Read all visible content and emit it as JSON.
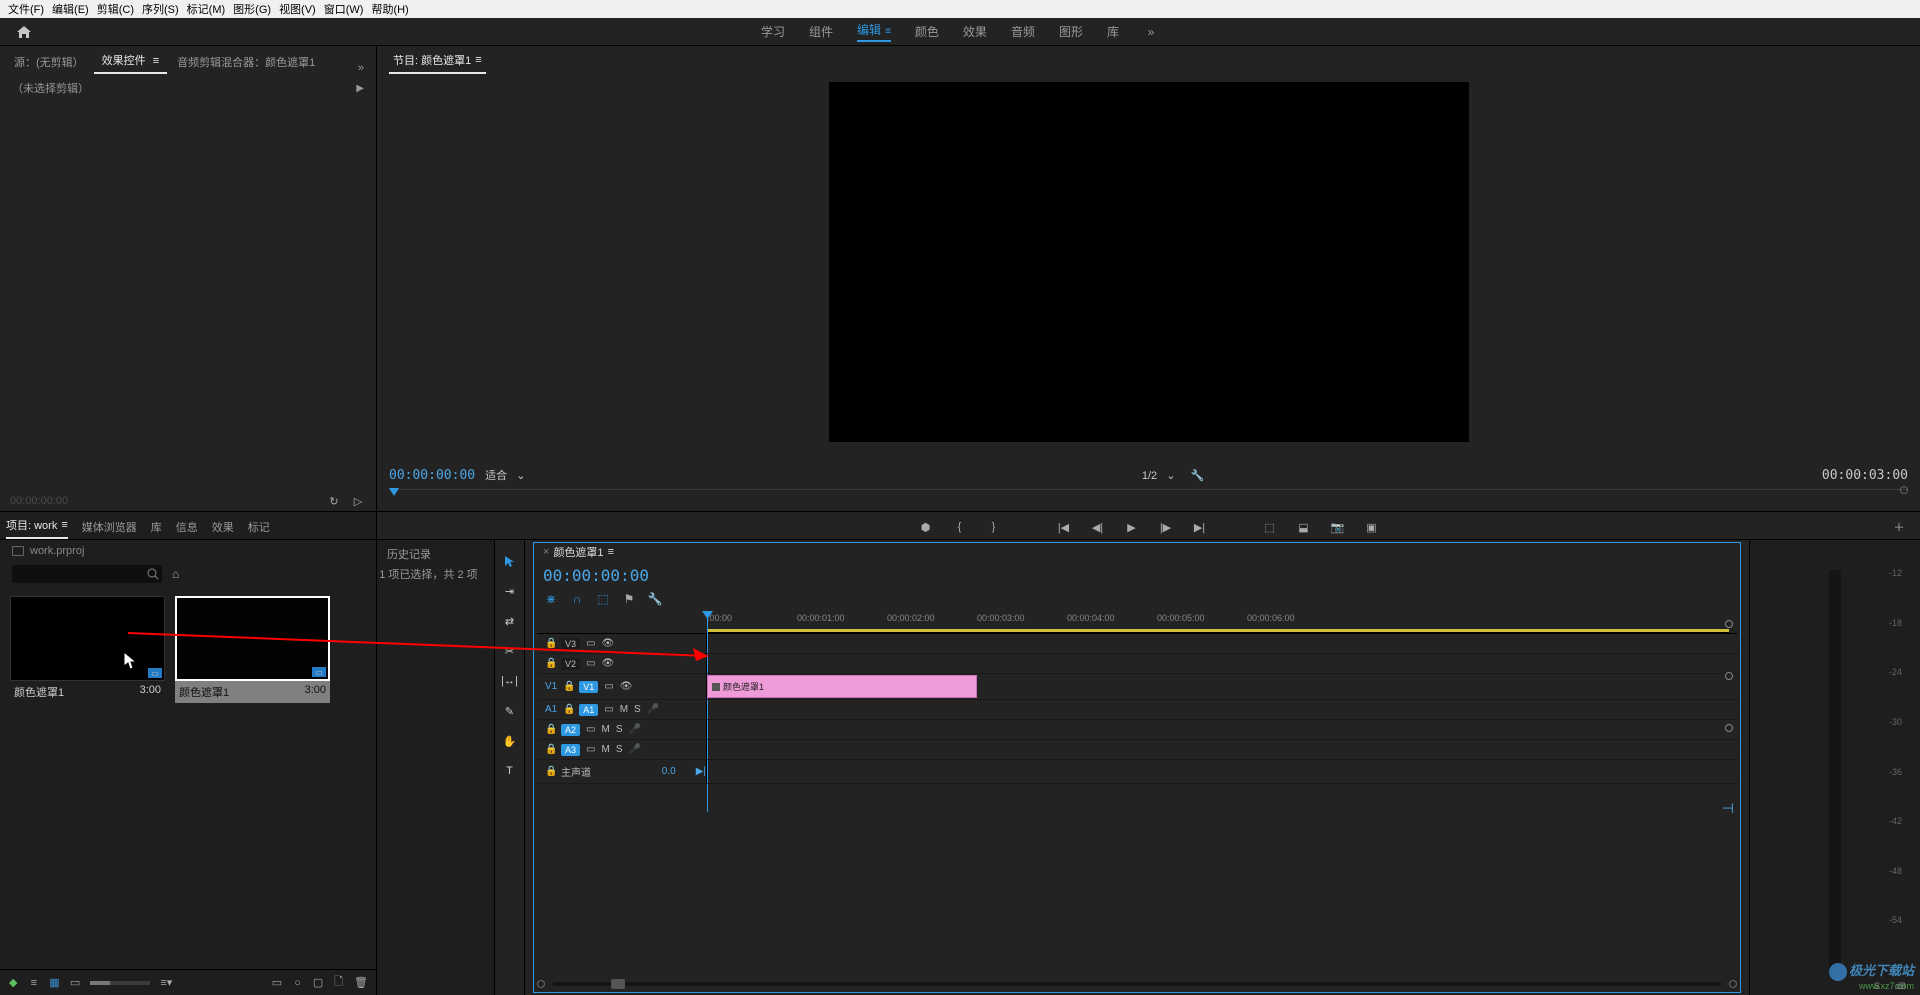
{
  "menu": {
    "file": "文件(F)",
    "edit": "编辑(E)",
    "clip": "剪辑(C)",
    "sequence": "序列(S)",
    "marker": "标记(M)",
    "graphics": "图形(G)",
    "view": "视图(V)",
    "window": "窗口(W)",
    "help": "帮助(H)"
  },
  "workspaces": {
    "learn": "学习",
    "assembly": "组件",
    "edit": "编辑",
    "color": "颜色",
    "effects": "效果",
    "audio": "音频",
    "graphics": "图形",
    "library": "库"
  },
  "source_panel": {
    "tab_source": "源：(无剪辑）",
    "tab_effects": "效果控件",
    "tab_mixer": "音频剪辑混合器：颜色遮罩1",
    "no_clip": "（未选择剪辑）",
    "tc": "00:00:00:00"
  },
  "project_panel": {
    "tab_project": "项目: work",
    "tab_media": "媒体浏览器",
    "tab_lib": "库",
    "tab_info": "信息",
    "tab_effects": "效果",
    "tab_markers": "标记",
    "tab_history": "历史记录",
    "project_file": "work.prproj",
    "search_placeholder": "",
    "selection_info": "1 项已选择，共 2 项",
    "items": [
      {
        "name": "颜色遮罩1",
        "dur": "3:00"
      },
      {
        "name": "颜色遮罩1",
        "dur": "3:00"
      }
    ]
  },
  "program": {
    "tab": "节目: 颜色遮罩1",
    "tc_left": "00:00:00:00",
    "fit": "适合",
    "res": "1/2",
    "tc_right": "00:00:03:00"
  },
  "timeline": {
    "seq": "颜色遮罩1",
    "tc": "00:00:00:00",
    "ruler": [
      ":00:00",
      "00:00:01:00",
      "00:00:02:00",
      "00:00:03:00",
      "00:00:04:00",
      "00:00:05:00",
      "00:00:06:00"
    ],
    "tracks_v": [
      "V3",
      "V2",
      "V1"
    ],
    "tracks_a": [
      "A1",
      "A2",
      "A3"
    ],
    "main_track": "主声道",
    "main_vol": "0.0",
    "clip": "颜色遮罩1"
  },
  "audiometer": {
    "ticks": [
      "-12",
      "-18",
      "-24",
      "-30",
      "-36",
      "-42",
      "-48",
      "-54",
      "- -"
    ],
    "s": "S",
    "db": "dB"
  },
  "watermark": {
    "l1": "极光下载站",
    "l2": "www.xz7.com"
  }
}
